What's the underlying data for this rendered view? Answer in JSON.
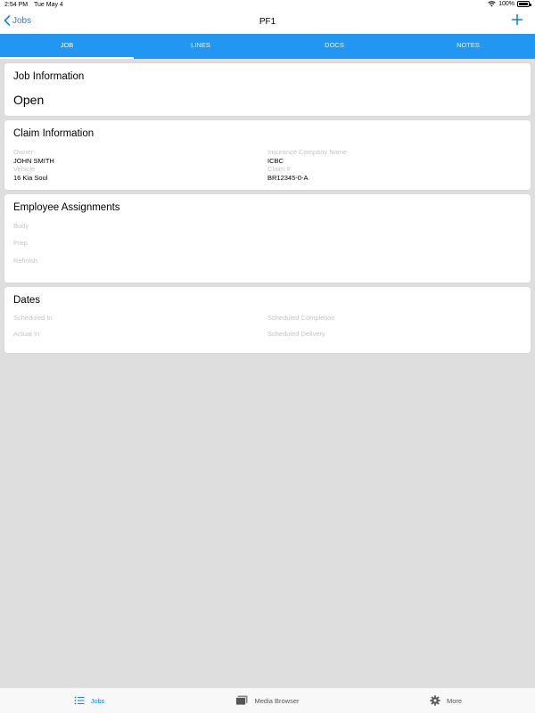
{
  "statusbar": {
    "time": "2:54 PM",
    "date": "Tue May 4",
    "battery": "100%"
  },
  "navbar": {
    "back_label": "Jobs",
    "title": "PF1"
  },
  "tabs": [
    {
      "label": "JOB"
    },
    {
      "label": "LINES"
    },
    {
      "label": "DOCS"
    },
    {
      "label": "NOTES"
    }
  ],
  "job_info": {
    "title": "Job Information",
    "status": "Open"
  },
  "claim_info": {
    "title": "Claim Information",
    "owner_label": "Owner",
    "owner_value": "JOHN SMITH",
    "vehicle_label": "Vehicle",
    "vehicle_value": "16 Kia Soul",
    "insurance_label": "Insurance Company Name",
    "insurance_value": "ICBC",
    "claim_label": "Claim #",
    "claim_value": "BR12345-0-A"
  },
  "employee": {
    "title": "Employee Assignments",
    "body_label": "Body",
    "prep_label": "Prep",
    "refinish_label": "Refinish"
  },
  "dates": {
    "title": "Dates",
    "scheduled_in": "Scheduled In",
    "actual_in": "Actual In",
    "scheduled_completion": "Scheduled Completion",
    "scheduled_delivery": "Scheduled Delivery"
  },
  "tabbar": [
    {
      "label": "Jobs",
      "icon": "list-icon"
    },
    {
      "label": "Media Browser",
      "icon": "media-icon"
    },
    {
      "label": "More",
      "icon": "gear-icon"
    }
  ],
  "colors": {
    "accent": "#2196f3",
    "link": "#1e7ff0",
    "background": "#dedede"
  }
}
